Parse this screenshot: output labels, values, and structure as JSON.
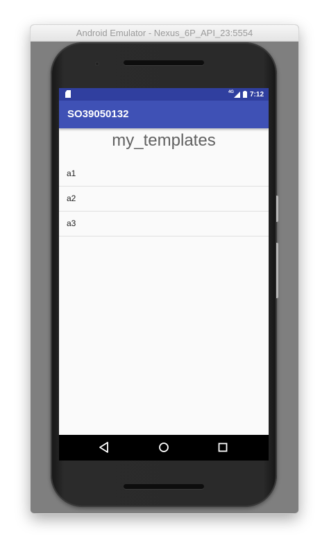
{
  "window": {
    "title": "Android Emulator - Nexus_6P_API_23:5554"
  },
  "statusbar": {
    "network_label": "4G",
    "time": "7:12",
    "icons": [
      "sd-card-icon",
      "signal-icon",
      "battery-icon"
    ]
  },
  "appbar": {
    "title": "SO39050132"
  },
  "content": {
    "title": "my_templates",
    "items": [
      {
        "label": "a1"
      },
      {
        "label": "a2"
      },
      {
        "label": "a3"
      }
    ]
  },
  "navbar": {
    "icons": [
      "back-icon",
      "home-icon",
      "recents-icon"
    ]
  },
  "colors": {
    "statusbar": "#303f9f",
    "appbar": "#3f51b5",
    "screen_bg": "#fafafa",
    "emulator_bg": "#7f7f7f"
  }
}
